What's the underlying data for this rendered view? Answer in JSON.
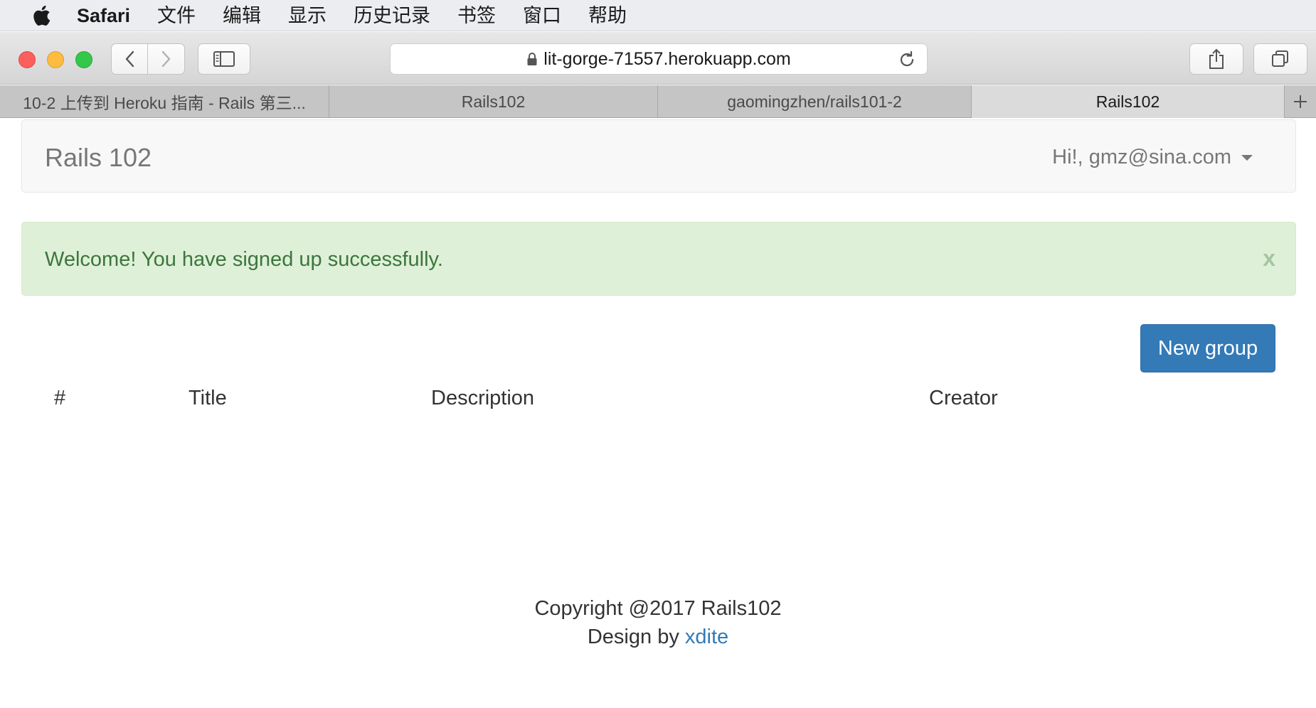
{
  "menubar": {
    "app_name": "Safari",
    "items": [
      "文件",
      "编辑",
      "显示",
      "历史记录",
      "书签",
      "窗口",
      "帮助"
    ]
  },
  "toolbar": {
    "url": "lit-gorge-71557.herokuapp.com"
  },
  "tabs": [
    {
      "label": "10-2 上传到 Heroku 指南 - Rails 第三..."
    },
    {
      "label": "Rails102"
    },
    {
      "label": "gaomingzhen/rails101-2"
    },
    {
      "label": "Rails102",
      "active": true
    }
  ],
  "navbar": {
    "brand": "Rails 102",
    "user_greeting": "Hi!, gmz@sina.com"
  },
  "alert": {
    "message": "Welcome! You have signed up successfully.",
    "close_label": "x"
  },
  "actions": {
    "new_group_label": "New group"
  },
  "table": {
    "headers": [
      "#",
      "Title",
      "Description",
      "Creator"
    ]
  },
  "footer": {
    "copyright": "Copyright @2017 Rails102",
    "design_prefix": "Design by ",
    "design_link": "xdite"
  },
  "colors": {
    "primary": "#337ab7",
    "alert_bg": "#dff0d8",
    "alert_text": "#3c763d"
  }
}
